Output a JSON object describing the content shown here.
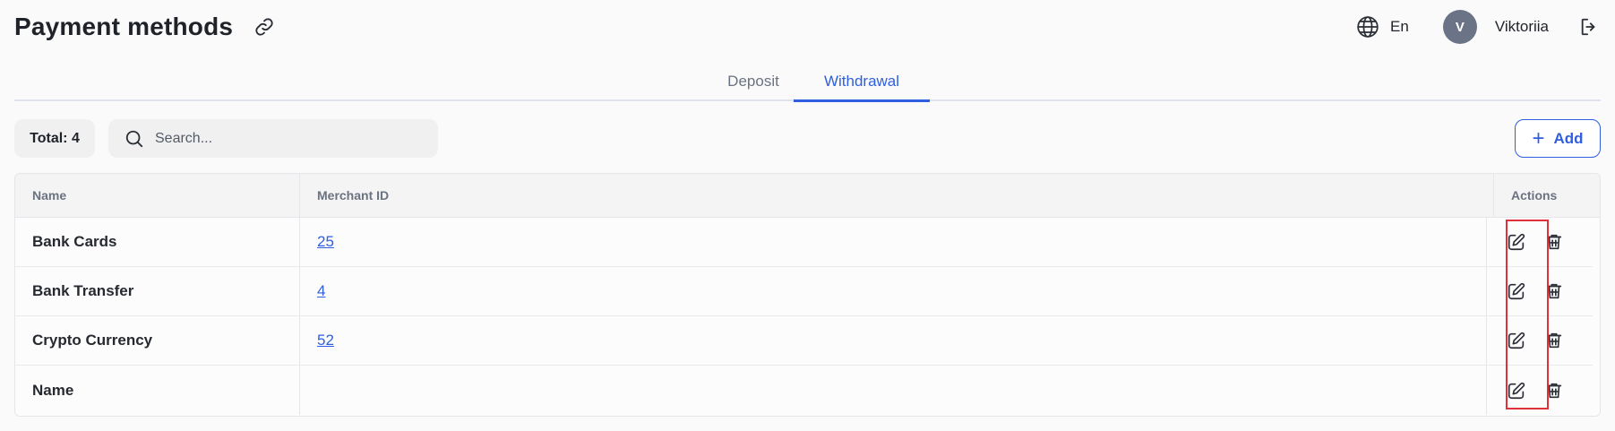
{
  "header": {
    "title": "Payment methods",
    "link_icon": "link-icon",
    "language": "En",
    "language_icon": "globe-icon",
    "avatar_initial": "V",
    "username": "Viktoriia",
    "logout_icon": "logout-icon"
  },
  "tabs": [
    {
      "label": "Deposit",
      "active": false
    },
    {
      "label": "Withdrawal",
      "active": true
    }
  ],
  "toolbar": {
    "total_label": "Total: 4",
    "search_placeholder": "Search...",
    "search_value": "",
    "add_label": "Add"
  },
  "table": {
    "columns": [
      "Name",
      "Merchant ID",
      "Actions"
    ],
    "rows": [
      {
        "name": "Bank Cards",
        "merchant_id": "25"
      },
      {
        "name": "Bank Transfer",
        "merchant_id": "4"
      },
      {
        "name": "Crypto Currency",
        "merchant_id": "52"
      },
      {
        "name": "Name",
        "merchant_id": ""
      }
    ]
  },
  "colors": {
    "accent": "#2f5fe0",
    "highlight": "#e0303a",
    "avatar_bg": "#6b7386"
  }
}
